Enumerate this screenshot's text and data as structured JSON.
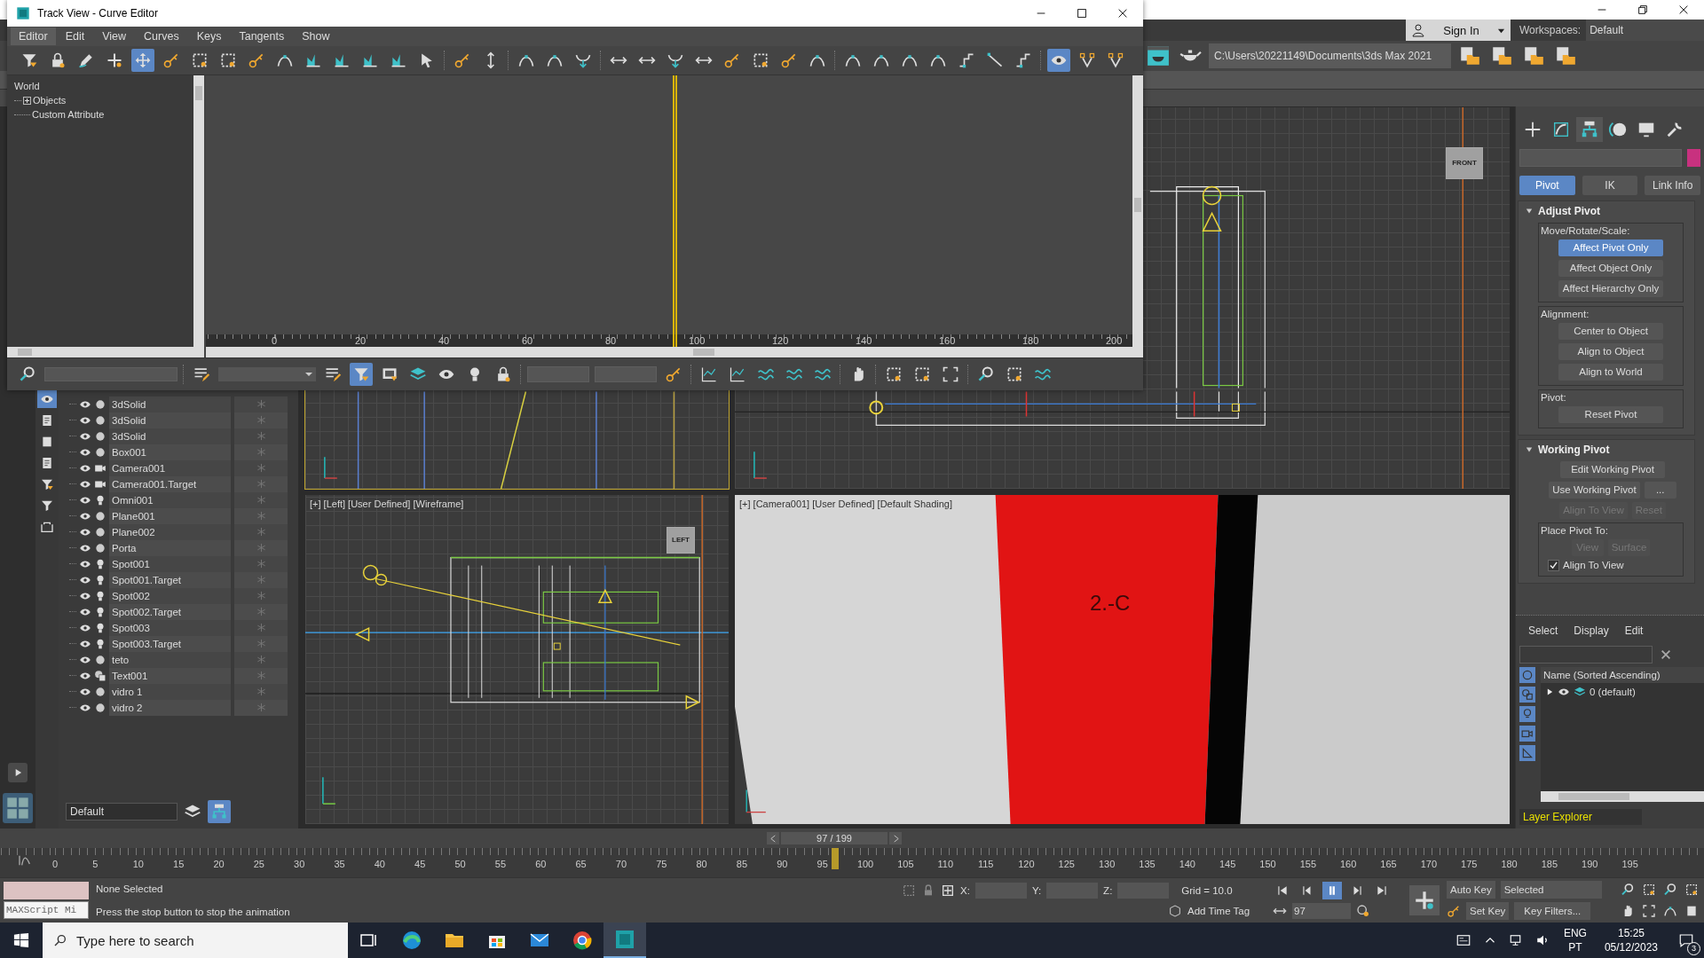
{
  "main_window": {
    "account": {
      "label": "Sign In"
    },
    "workspaces": {
      "label": "Workspaces:",
      "value": "Default"
    },
    "project_path": "C:\\Users\\20221149\\Documents\\3ds Max 2021"
  },
  "track_view": {
    "title": "Track View - Curve Editor",
    "menu": [
      {
        "label": "Editor",
        "selected": true
      },
      {
        "label": "Edit",
        "selected": false
      },
      {
        "label": "View",
        "selected": false
      },
      {
        "label": "Curves",
        "selected": false
      },
      {
        "label": "Keys",
        "selected": false
      },
      {
        "label": "Tangents",
        "selected": false
      },
      {
        "label": "Show",
        "selected": false
      }
    ],
    "toolbar": [
      {
        "selected": false
      },
      {
        "selected": false
      },
      {
        "selected": false
      },
      {
        "selected": false
      },
      {
        "selected": true
      },
      {
        "selected": false
      },
      {
        "selected": false
      },
      {
        "selected": false
      },
      {
        "selected": false
      },
      {
        "selected": false
      },
      {
        "selected": false
      },
      {
        "selected": false
      },
      {
        "selected": false
      },
      {
        "selected": false
      },
      {
        "selected": false
      },
      {
        "selected": false
      },
      {
        "selected": false
      },
      {
        "selected": false
      },
      {
        "selected": false
      },
      {
        "selected": false
      },
      {
        "selected": false
      },
      {
        "selected": false
      },
      {
        "selected": false
      },
      {
        "selected": false
      },
      {
        "selected": false
      },
      {
        "selected": false
      },
      {
        "selected": false
      },
      {
        "selected": false
      },
      {
        "selected": false
      },
      {
        "selected": false
      },
      {
        "selected": false
      },
      {
        "selected": false
      },
      {
        "selected": false
      },
      {
        "selected": false
      },
      {
        "selected": false
      },
      {
        "selected": true
      },
      {
        "selected": false
      },
      {
        "selected": false
      }
    ],
    "tree": [
      {
        "label": "World",
        "children": [
          {
            "label": "Objects",
            "expanded": false
          },
          {
            "label": "Custom Attribute"
          }
        ]
      }
    ],
    "ruler": [
      "0",
      "20",
      "40",
      "60",
      "80",
      "100",
      "120",
      "140",
      "160",
      "180",
      "200"
    ],
    "time_marker": {
      "level": 0.504
    },
    "filter_toolbar": [
      {
        "selected": false
      },
      {
        "selected": true
      },
      {
        "selected": false
      },
      {
        "selected": false
      },
      {
        "selected": false
      },
      {
        "selected": false
      },
      {
        "selected": false
      }
    ]
  },
  "scene_explorer": {
    "sidebar": [
      {
        "selected": true
      },
      {
        "selected": false
      },
      {
        "selected": false
      },
      {
        "selected": false
      },
      {
        "selected": false
      },
      {
        "selected": false
      },
      {
        "selected": false
      }
    ],
    "objects": [
      {
        "name": "3dSolid",
        "kind": "geometry"
      },
      {
        "name": "3dSolid",
        "kind": "geometry"
      },
      {
        "name": "3dSolid",
        "kind": "geometry"
      },
      {
        "name": "Box001",
        "kind": "geometry"
      },
      {
        "name": "Camera001",
        "kind": "camera"
      },
      {
        "name": "Camera001.Target",
        "kind": "camera"
      },
      {
        "name": "Omni001",
        "kind": "light"
      },
      {
        "name": "Plane001",
        "kind": "geometry"
      },
      {
        "name": "Plane002",
        "kind": "geometry"
      },
      {
        "name": "Porta",
        "kind": "geometry"
      },
      {
        "name": "Spot001",
        "kind": "light"
      },
      {
        "name": "Spot001.Target",
        "kind": "light"
      },
      {
        "name": "Spot002",
        "kind": "light"
      },
      {
        "name": "Spot002.Target",
        "kind": "light"
      },
      {
        "name": "Spot003",
        "kind": "light"
      },
      {
        "name": "Spot003.Target",
        "kind": "light"
      },
      {
        "name": "teto",
        "kind": "geometry"
      },
      {
        "name": "Text001",
        "kind": "shape"
      },
      {
        "name": "vidro 1",
        "kind": "geometry"
      },
      {
        "name": "vidro 2",
        "kind": "geometry"
      }
    ],
    "layer": "Default"
  },
  "viewports": [
    {
      "kind": "top",
      "selected": true
    },
    {
      "kind": "front",
      "selected": false,
      "cube": "FRONT"
    },
    {
      "kind": "left",
      "selected": false,
      "label": "[+] [Left] [User Defined] [Wireframe]",
      "cube": "LEFT"
    },
    {
      "kind": "camera",
      "selected": false,
      "label": "[+] [Camera001] [User Defined] [Default Shading]",
      "object_text": "2.-C"
    }
  ],
  "command_panel": {
    "tabs": [
      {
        "selected": false
      },
      {
        "selected": false
      },
      {
        "selected": true
      },
      {
        "selected": false
      },
      {
        "selected": false
      },
      {
        "selected": false
      }
    ],
    "modes": [
      {
        "label": "Pivot",
        "selected": true
      },
      {
        "label": "IK",
        "selected": false
      },
      {
        "label": "Link Info",
        "selected": false
      }
    ],
    "rollouts": [
      {
        "title": "Adjust Pivot",
        "expanded": true,
        "groups": [
          {
            "label": "Move/Rotate/Scale:",
            "rows": [
              [
                {
                  "label": "Affect Pivot Only",
                  "selected": true,
                  "disabled": false
                }
              ],
              [
                {
                  "label": "Affect Object Only",
                  "selected": false,
                  "disabled": false
                }
              ],
              [
                {
                  "label": "Affect Hierarchy Only",
                  "selected": false,
                  "disabled": false
                }
              ]
            ]
          },
          {
            "label": "Alignment:",
            "rows": [
              [
                {
                  "label": "Center to Object",
                  "selected": false,
                  "disabled": false
                }
              ],
              [
                {
                  "label": "Align to Object",
                  "selected": false,
                  "disabled": false
                }
              ],
              [
                {
                  "label": "Align to World",
                  "selected": false,
                  "disabled": false
                }
              ]
            ]
          },
          {
            "label": "Pivot:",
            "rows": [
              [
                {
                  "label": "Reset Pivot",
                  "selected": false,
                  "disabled": false
                }
              ]
            ]
          }
        ]
      },
      {
        "title": "Working Pivot",
        "expanded": true,
        "groups": [
          {
            "rows": [
              [
                {
                  "label": "Edit Working Pivot",
                  "selected": false,
                  "disabled": false
                }
              ],
              [
                {
                  "label": "Use Working Pivot",
                  "selected": false,
                  "disabled": false
                },
                {
                  "label": "...",
                  "selected": false,
                  "disabled": false
                }
              ],
              [
                {
                  "label": "Align To View",
                  "selected": false,
                  "disabled": true
                },
                {
                  "label": "Reset",
                  "selected": false,
                  "disabled": true
                }
              ]
            ]
          },
          {
            "label": "Place Pivot To:",
            "rows": [
              [
                {
                  "label": "View",
                  "selected": false,
                  "disabled": true
                },
                {
                  "label": "Surface",
                  "selected": false,
                  "disabled": true
                }
              ]
            ],
            "checkbox": {
              "label": "Align To View",
              "checked": true
            }
          }
        ]
      }
    ]
  },
  "layer_explorer": {
    "menu": [
      "Select",
      "Display",
      "Edit"
    ],
    "column": "Name (Sorted Ascending)",
    "layers": [
      {
        "name": "0 (default)",
        "expanded": false
      }
    ],
    "title": "Layer Explorer"
  },
  "timeline": {
    "frame": "97 / 199",
    "level": 0.487,
    "labels": [
      "0",
      "5",
      "10",
      "15",
      "20",
      "25",
      "30",
      "35",
      "40",
      "45",
      "50",
      "55",
      "60",
      "65",
      "70",
      "75",
      "80",
      "85",
      "90",
      "95",
      "100",
      "105",
      "110",
      "115",
      "120",
      "125",
      "130",
      "135",
      "140",
      "145",
      "150",
      "155",
      "160",
      "165",
      "170",
      "175",
      "180",
      "185",
      "190",
      "195"
    ]
  },
  "status": {
    "script_field": "MAXScript Mi",
    "selection": "None Selected",
    "prompt": "Press the stop button to stop the animation",
    "coords": [
      "X:",
      "Y:",
      "Z:"
    ],
    "grid": "Grid = 10.0",
    "time_tag": "Add Time Tag",
    "playback": [
      {
        "selected": false
      },
      {
        "selected": false
      },
      {
        "selected": true
      },
      {
        "selected": false
      },
      {
        "selected": false
      }
    ],
    "current_frame": "97",
    "auto_key": "Auto Key",
    "key_set": "Selected",
    "set_key": "Set Key",
    "key_filters": "Key Filters..."
  },
  "taskbar": {
    "search_placeholder": "Type here to search",
    "apps": [
      {
        "selected": false
      },
      {
        "selected": false
      },
      {
        "selected": false
      },
      {
        "selected": false
      },
      {
        "selected": false
      },
      {
        "selected": false
      },
      {
        "selected": true
      }
    ],
    "language": "ENG",
    "region": "PT",
    "time": "15:25",
    "date": "05/12/2023",
    "notifications": "3"
  }
}
